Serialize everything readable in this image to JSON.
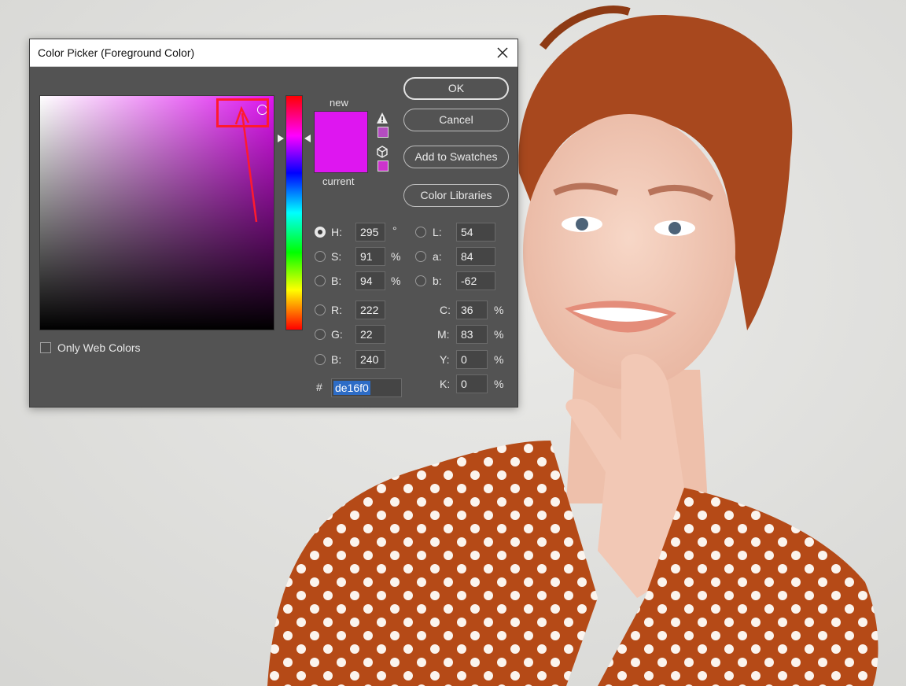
{
  "dialog": {
    "title": "Color Picker (Foreground Color)",
    "buttons": {
      "ok": "OK",
      "cancel": "Cancel",
      "add_swatches": "Add to Swatches",
      "color_libraries": "Color Libraries"
    },
    "swatch_labels": {
      "new": "new",
      "current": "current"
    },
    "new_color": "#de16f0",
    "current_color": "#de16f0",
    "only_web_colors": {
      "label": "Only Web Colors",
      "checked": false
    },
    "fields": {
      "H": {
        "label": "H:",
        "value": "295",
        "unit": "°",
        "selected": true
      },
      "S": {
        "label": "S:",
        "value": "91",
        "unit": "%"
      },
      "Bri": {
        "label": "B:",
        "value": "94",
        "unit": "%"
      },
      "R": {
        "label": "R:",
        "value": "222"
      },
      "G": {
        "label": "G:",
        "value": "22"
      },
      "Blue": {
        "label": "B:",
        "value": "240"
      },
      "L": {
        "label": "L:",
        "value": "54"
      },
      "a": {
        "label": "a:",
        "value": "84"
      },
      "b": {
        "label": "b:",
        "value": "-62"
      },
      "C": {
        "label": "C:",
        "value": "36",
        "unit": "%"
      },
      "M": {
        "label": "M:",
        "value": "83",
        "unit": "%"
      },
      "Y": {
        "label": "Y:",
        "value": "0",
        "unit": "%"
      },
      "K": {
        "label": "K:",
        "value": "0",
        "unit": "%"
      }
    },
    "hex": {
      "label": "#",
      "value": "de16f0"
    }
  },
  "colors": {
    "annotation": "#ff1a2e",
    "dialog_bg": "#535353"
  },
  "icons": [
    "close-icon",
    "gamut-warning-icon",
    "web-safe-cube-icon"
  ]
}
